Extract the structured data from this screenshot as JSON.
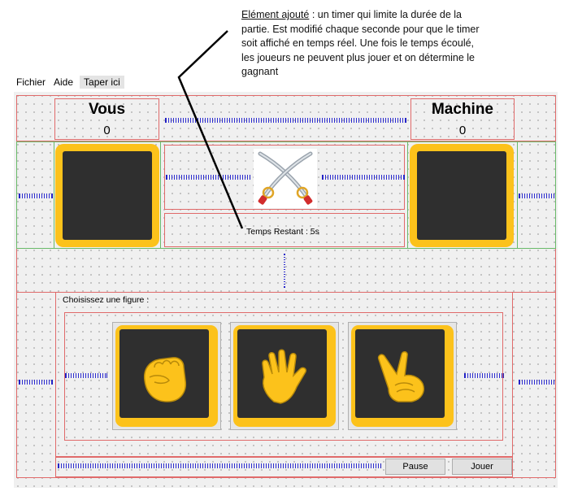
{
  "annotation": {
    "title": "Elément ajouté",
    "text": " : un timer qui limite la durée de la partie. Est modifié chaque seconde pour que le timer soit affiché en temps réel. Une fois le temps écoulé, les joueurs ne peuvent plus jouer et on détermine le gagnant"
  },
  "menu": {
    "items": [
      "Fichier",
      "Aide",
      "Taper ici"
    ]
  },
  "players": {
    "human": {
      "name": "Vous",
      "score": "0"
    },
    "machine": {
      "name": "Machine",
      "score": "0"
    }
  },
  "timer": {
    "text": "Temps Restant : 5s"
  },
  "choices": {
    "prompt": "Choisissez une figure :",
    "items": [
      {
        "icon": "fist-rock-icon"
      },
      {
        "icon": "open-hand-paper-icon"
      },
      {
        "icon": "victory-hand-scissors-icon"
      }
    ]
  },
  "buttons": {
    "pause": "Pause",
    "play": "Jouer"
  },
  "colors": {
    "accent": "#fcc21b",
    "slot_dark": "#2f2f2f",
    "layout_border": "#e06a6a",
    "spacer": "#2a2ad0"
  }
}
